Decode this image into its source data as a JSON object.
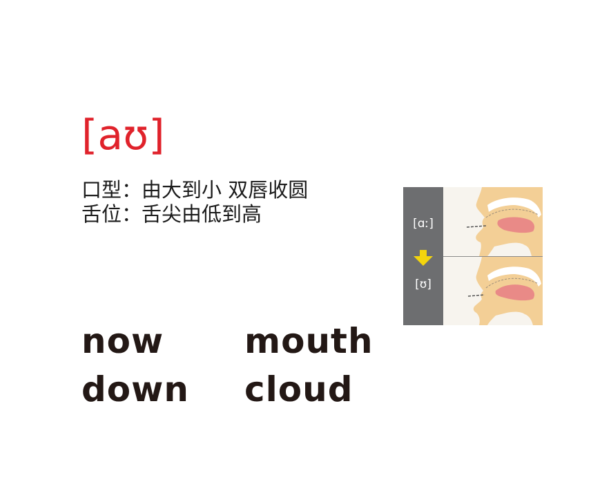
{
  "phoneme": "[aʊ]",
  "mouth_shape": {
    "label": "口型：",
    "text": "由大到小 双唇收圆"
  },
  "tongue_position": {
    "label": "舌位：",
    "text": "舌尖由低到高"
  },
  "words": [
    "now",
    "mouth",
    "down",
    "cloud"
  ],
  "diagram": {
    "start_symbol": "[ɑː]",
    "end_symbol": "[ʊ]",
    "sidebar_color": "#6d6e70",
    "arrow_color": "#f4d50c",
    "skin_color": "#f3cf96",
    "tongue_color": "#e98a87"
  }
}
